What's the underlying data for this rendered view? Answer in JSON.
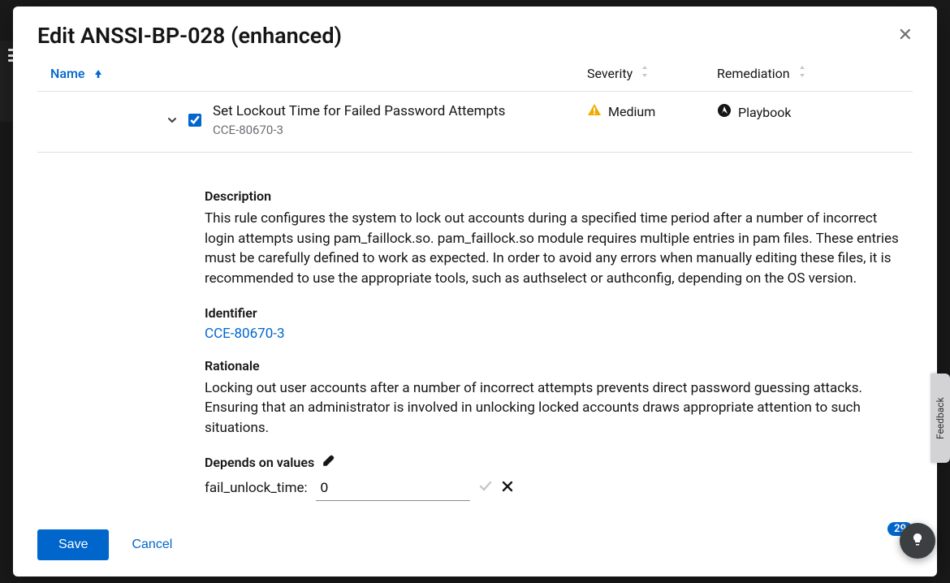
{
  "modal": {
    "title": "Edit ANSSI-BP-028 (enhanced)"
  },
  "columns": {
    "name": "Name",
    "severity": "Severity",
    "remediation": "Remediation"
  },
  "rule": {
    "title": "Set Lockout Time for Failed Password Attempts",
    "id": "CCE-80670-3",
    "severity": "Medium",
    "remediation": "Playbook",
    "checked": true
  },
  "detail": {
    "description_label": "Description",
    "description": "This rule configures the system to lock out accounts during a specified time period after a number of incorrect login attempts using pam_faillock.so. pam_faillock.so module requires multiple entries in pam files. These entries must be carefully defined to work as expected. In order to avoid any errors when manually editing these files, it is recommended to use the appropriate tools, such as authselect or authconfig, depending on the OS version.",
    "identifier_label": "Identifier",
    "identifier": "CCE-80670-3",
    "rationale_label": "Rationale",
    "rationale": "Locking out user accounts after a number of incorrect attempts prevents direct password guessing attacks. Ensuring that an administrator is involved in unlocking locked accounts draws appropriate attention to such situations.",
    "depends_label": "Depends on values",
    "value_key": "fail_unlock_time:",
    "value": "0"
  },
  "footer": {
    "save": "Save",
    "cancel": "Cancel"
  },
  "side": {
    "feedback": "Feedback",
    "helper_count": "29"
  }
}
